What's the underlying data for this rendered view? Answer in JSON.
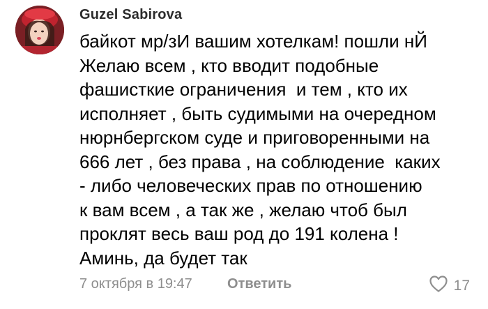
{
  "comment": {
    "author": "Guzel Sabirova",
    "avatar_icon": "avatar-photo",
    "lines": [
      "байкот мр/зИ вашим хотелкам! пошли нЙ",
      "Желаю всем , кто вводит подобные",
      "фашисткие ограничения  и тем , кто их",
      "исполняет , быть судимыми на очередном",
      "нюрнбергском суде и приговоренными на",
      "666 лет , без права , на соблюдение  каких",
      "- либо человеческих прав по отношению",
      "к вам всем , а так же , желаю чтоб был",
      "проклят весь ваш род до 191 колена !",
      "Аминь, да будет так"
    ],
    "timestamp": "7 октября в 19:47",
    "reply_label": "Ответить",
    "like_icon": "heart-icon",
    "like_count": "17"
  },
  "colors": {
    "text": "#000000",
    "author": "#2b2b2b",
    "meta": "#8e8e8e"
  }
}
